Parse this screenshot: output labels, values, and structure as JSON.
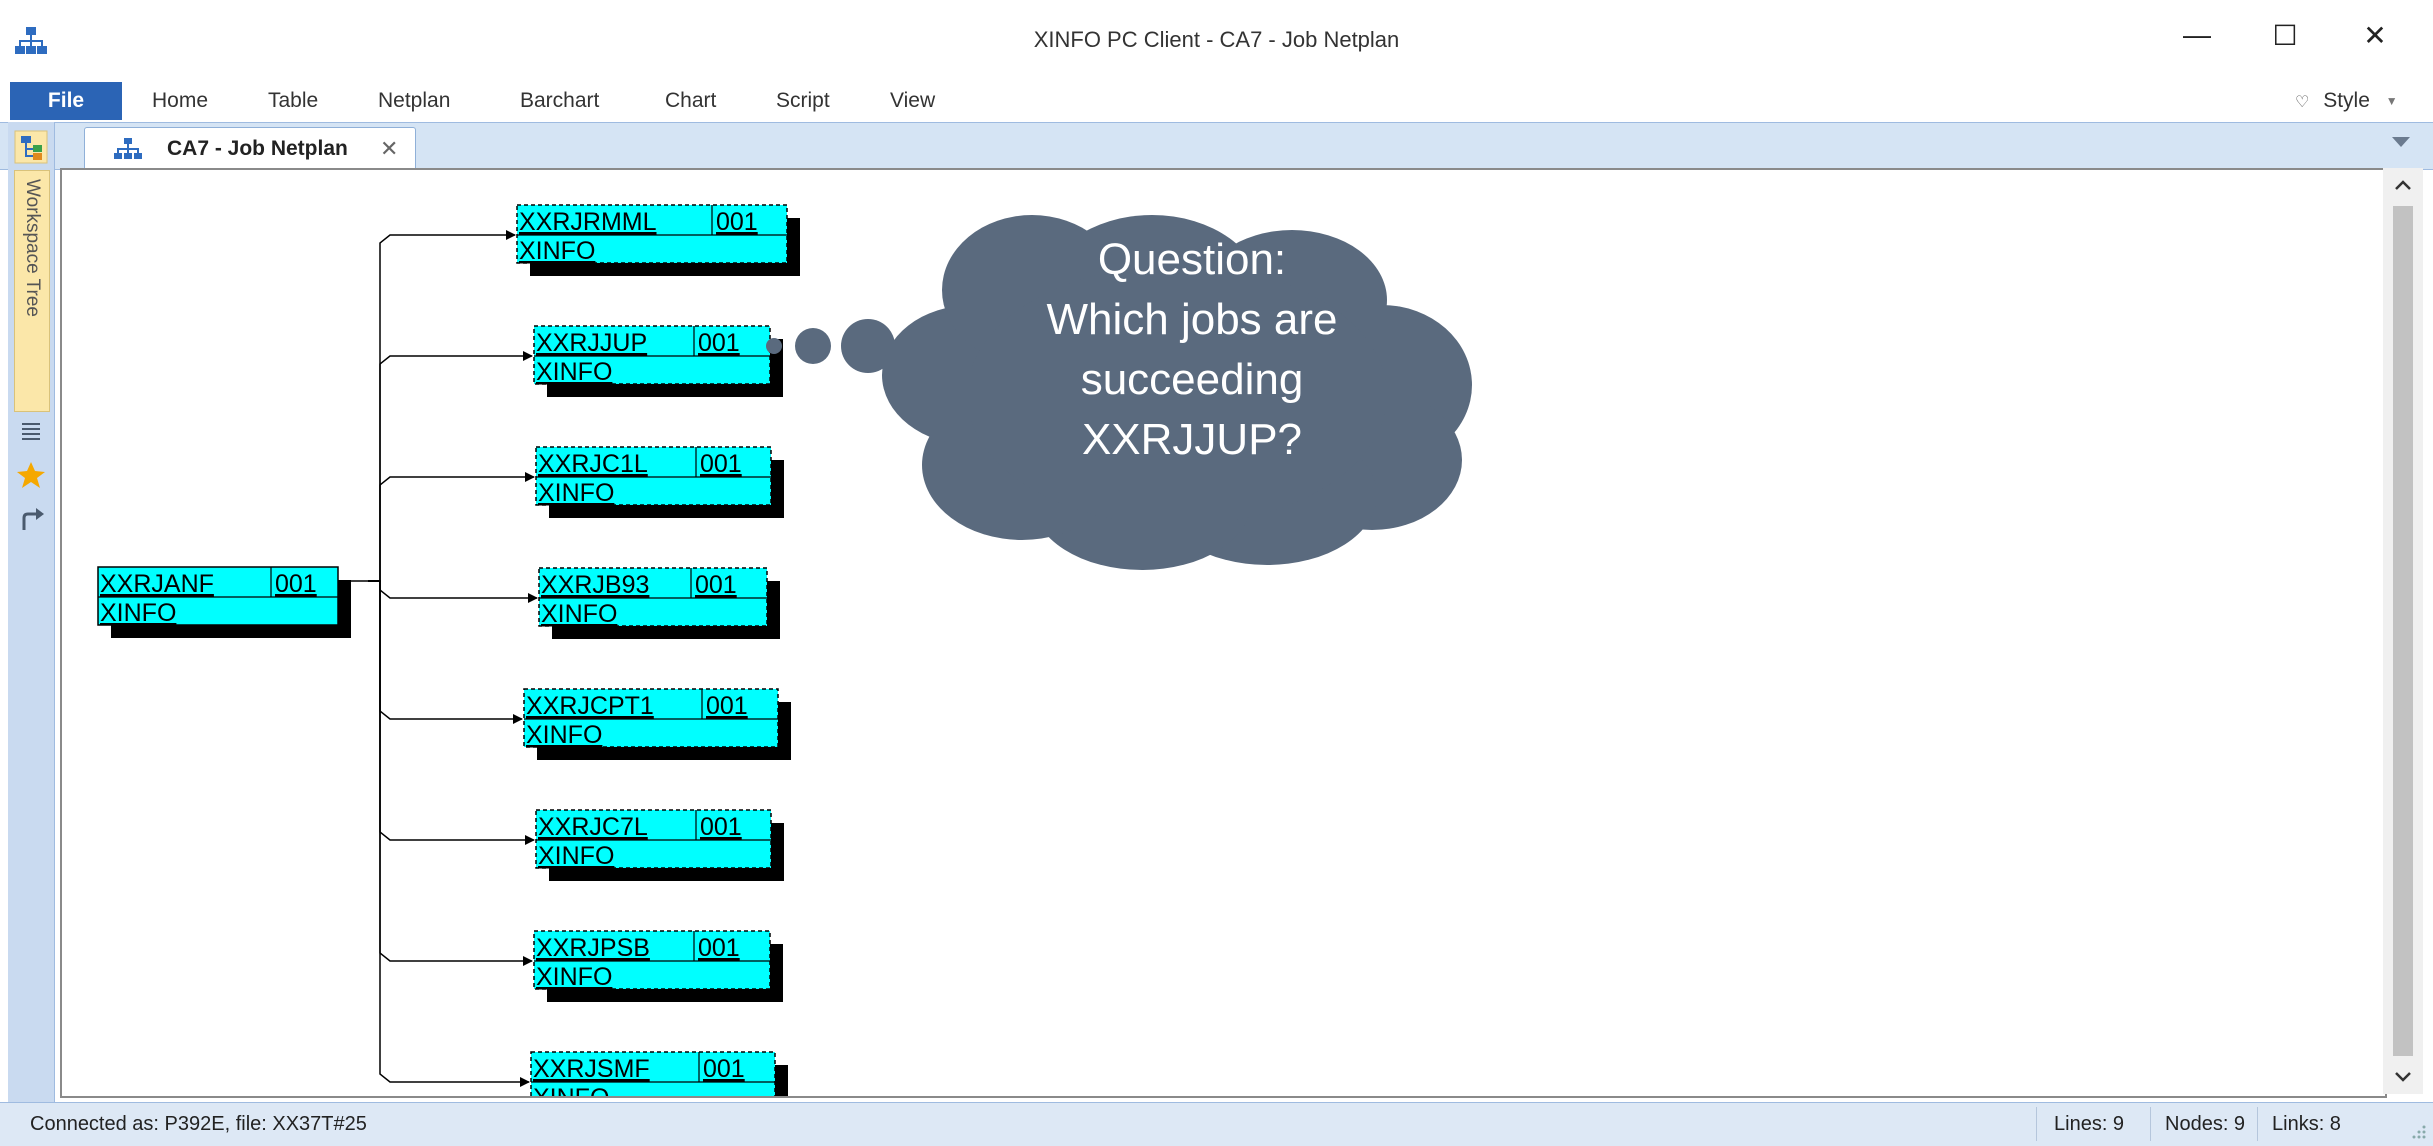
{
  "window": {
    "title": "XINFO PC Client - CA7 - Job Netplan",
    "minimize_glyph": "—",
    "maximize_glyph": "☐",
    "close_glyph": "✕"
  },
  "ribbon": {
    "file_label": "File",
    "menu": [
      "Home",
      "Table",
      "Netplan",
      "Barchart",
      "Chart",
      "Script",
      "View"
    ],
    "style_label": "Style"
  },
  "tab": {
    "label": "CA7 - Job Netplan",
    "close_glyph": "✕"
  },
  "sidebar": {
    "workspace_label": "Workspace Tree"
  },
  "netplan": {
    "root": {
      "name": "XXRJANF",
      "seq": "001",
      "system": "XINFO"
    },
    "successors": [
      {
        "name": "XXRJRMML",
        "seq": "001",
        "system": "XINFO"
      },
      {
        "name": "XXRJJUP",
        "seq": "001",
        "system": "XINFO"
      },
      {
        "name": "XXRJC1L",
        "seq": "001",
        "system": "XINFO"
      },
      {
        "name": "XXRJB93",
        "seq": "001",
        "system": "XINFO"
      },
      {
        "name": "XXRJCPT1",
        "seq": "001",
        "system": "XINFO"
      },
      {
        "name": "XXRJC7L",
        "seq": "001",
        "system": "XINFO"
      },
      {
        "name": "XXRJPSB",
        "seq": "001",
        "system": "XINFO"
      },
      {
        "name": "XXRJSMF",
        "seq": "001",
        "system": "XINFO"
      }
    ],
    "node_color": "#00ffff",
    "shadow_color": "#000000"
  },
  "callout": {
    "lines": [
      "Question:",
      "Which jobs are",
      "succeeding",
      "XXRJJUP?"
    ],
    "color": "#5a6a7e"
  },
  "status": {
    "connected": "Connected as: P392E, file: XX37T#25",
    "lines": "Lines: 9",
    "nodes": "Nodes: 9",
    "links": "Links: 8"
  },
  "icons": {
    "app": "sitemap-icon",
    "workspace_toggle": "tree-icon",
    "list": "list-icon",
    "favorites": "star-icon",
    "goto": "forward-arrow-icon",
    "style": "heart-icon"
  }
}
